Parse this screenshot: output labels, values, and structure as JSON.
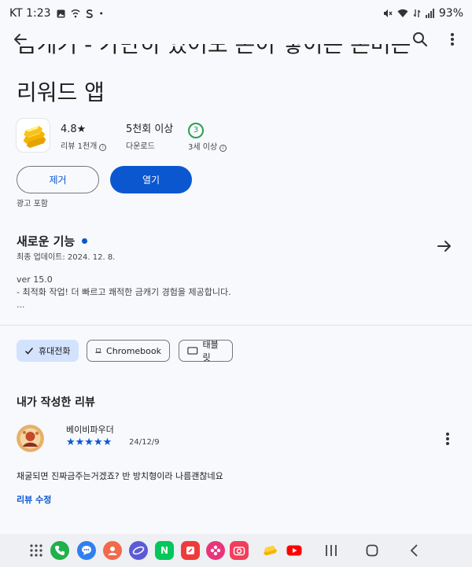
{
  "status_bar": {
    "carrier_time": "KT 1:23",
    "battery": "93%",
    "notification_icons": [
      "gallery-icon",
      "wifi-call-icon",
      "s-pay-icon",
      "dot-icon"
    ],
    "system_icons": [
      "mute-icon",
      "wifi-icon",
      "volte-icon",
      "signal-icon"
    ]
  },
  "app_bar": {
    "icons": [
      "back-arrow-icon",
      "search-icon",
      "more-vertical-icon"
    ]
  },
  "app": {
    "title_line1": "금캐기 - 가만히 있어도 돈이 쌓이는 돈버는",
    "title_line2": "리워드 앱",
    "icon": "gold-bars-icon",
    "rating_value": "4.8★",
    "rating_label": "리뷰 1천개",
    "downloads_value": "5천회 이상",
    "downloads_label": "다운로드",
    "age_value": "3",
    "age_label": "3세 이상"
  },
  "actions": {
    "remove_label": "제거",
    "open_label": "열기",
    "ads_label": "광고 포함"
  },
  "whats_new": {
    "title": "새로운 기능",
    "updated": "최종 업데이트: 2024. 12. 8.",
    "version": "ver 15.0",
    "note": "- 최적화 작업! 더 빠르고 쾌적한 금캐기 경험을 제공합니다.",
    "ellipsis": "..."
  },
  "device_chips": [
    {
      "label": "휴대전화",
      "icon": "checkmark-icon",
      "selected": true
    },
    {
      "label": "Chromebook",
      "icon": "laptop-icon",
      "selected": false
    },
    {
      "label": "태블릿",
      "icon": "tablet-icon",
      "selected": false
    }
  ],
  "my_review": {
    "heading": "내가 작성한 리뷰",
    "reviewer": "베이비파우더",
    "stars": "★★★★★",
    "rating": 5,
    "date": "24/12/9",
    "text": "채굴되면 진짜금주는거겠죠? 반 방치형이라 나름괜찮네요",
    "edit_label": "리뷰 수정"
  },
  "dock": {
    "apps": [
      "app-drawer-icon",
      "phone-icon",
      "messages-icon",
      "contacts-icon",
      "internet-icon",
      "naver-icon",
      "notes-icon",
      "gallery-flower-icon",
      "camera-icon",
      "gold-app-icon",
      "youtube-icon"
    ],
    "nav": [
      "recents-icon",
      "home-icon",
      "back-nav-icon"
    ]
  },
  "colors": {
    "accent": "#0b57d0",
    "background": "#f7f9fd",
    "selected_chip": "#d3e3fd",
    "age_badge": "#2e9d4f"
  }
}
